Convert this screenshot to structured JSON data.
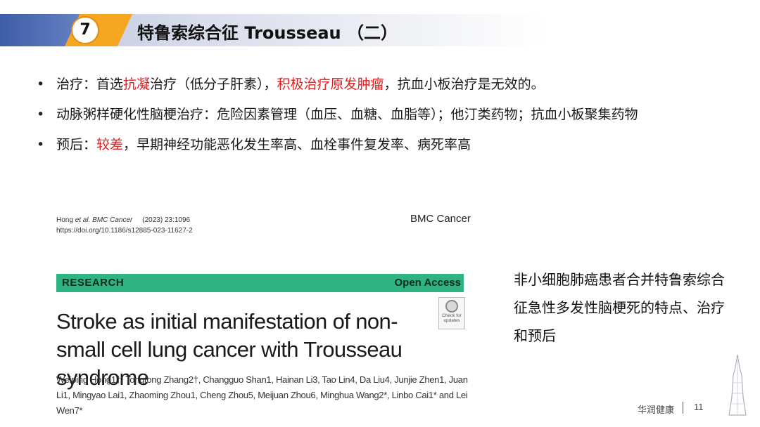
{
  "header": {
    "number": "7",
    "title": "特鲁索综合征 Trousseau （二）"
  },
  "bullets": [
    {
      "segments": [
        {
          "text": "治疗：首选",
          "color": "normal"
        },
        {
          "text": "抗凝",
          "color": "red"
        },
        {
          "text": "治疗（低分子肝素），",
          "color": "normal"
        },
        {
          "text": "积极治疗原发肿瘤",
          "color": "red"
        },
        {
          "text": "，抗血小板治疗是无效的。",
          "color": "normal"
        }
      ]
    },
    {
      "segments": [
        {
          "text": "动脉粥样硬化性脑梗治疗：危险因素管理（血压、血糖、血脂等）；他汀类药物；抗血小板聚集药物",
          "color": "normal"
        }
      ]
    },
    {
      "segments": [
        {
          "text": "预后：",
          "color": "normal"
        },
        {
          "text": "较差",
          "color": "red"
        },
        {
          "text": "，早期神经功能恶化发生率高、血栓事件复发率、病死率高",
          "color": "normal"
        }
      ]
    }
  ],
  "paper": {
    "citation_authors": "Hong ",
    "citation_etal": "et al. BMC Cancer",
    "citation_year": "     (2023) 23:1096",
    "doi": "https://doi.org/10.1186/s12885-023-11627-2",
    "journal": "BMC Cancer",
    "section_label": "RESEARCH",
    "access_label": "Open Access",
    "title": "Stroke as initial manifestation of non-small cell lung cancer with Trousseau syndrome",
    "check_updates": "Check for updates",
    "authors": "Weiping Hong1†, Tongtong Zhang2†, Changguo Shan1, Hainan Li3, Tao Lin4, Da Liu4, Junjie Zhen1, Juan Li1, Mingyao Lai1, Zhaoming Zhou1, Cheng Zhou5, Meijuan Zhou6, Minghua Wang2*, Linbo Cai1* and Lei Wen7*"
  },
  "side_note": "非小细胞肺癌患者合并特鲁索综合征急性多发性脑梗死的特点、治疗和预后",
  "footer": {
    "brand": "华润健康",
    "page": "11"
  },
  "colors": {
    "accent_red": "#e02020",
    "research_bar": "#30b383",
    "header_orange": "#f5a623",
    "header_blue": "#3f5da8"
  }
}
